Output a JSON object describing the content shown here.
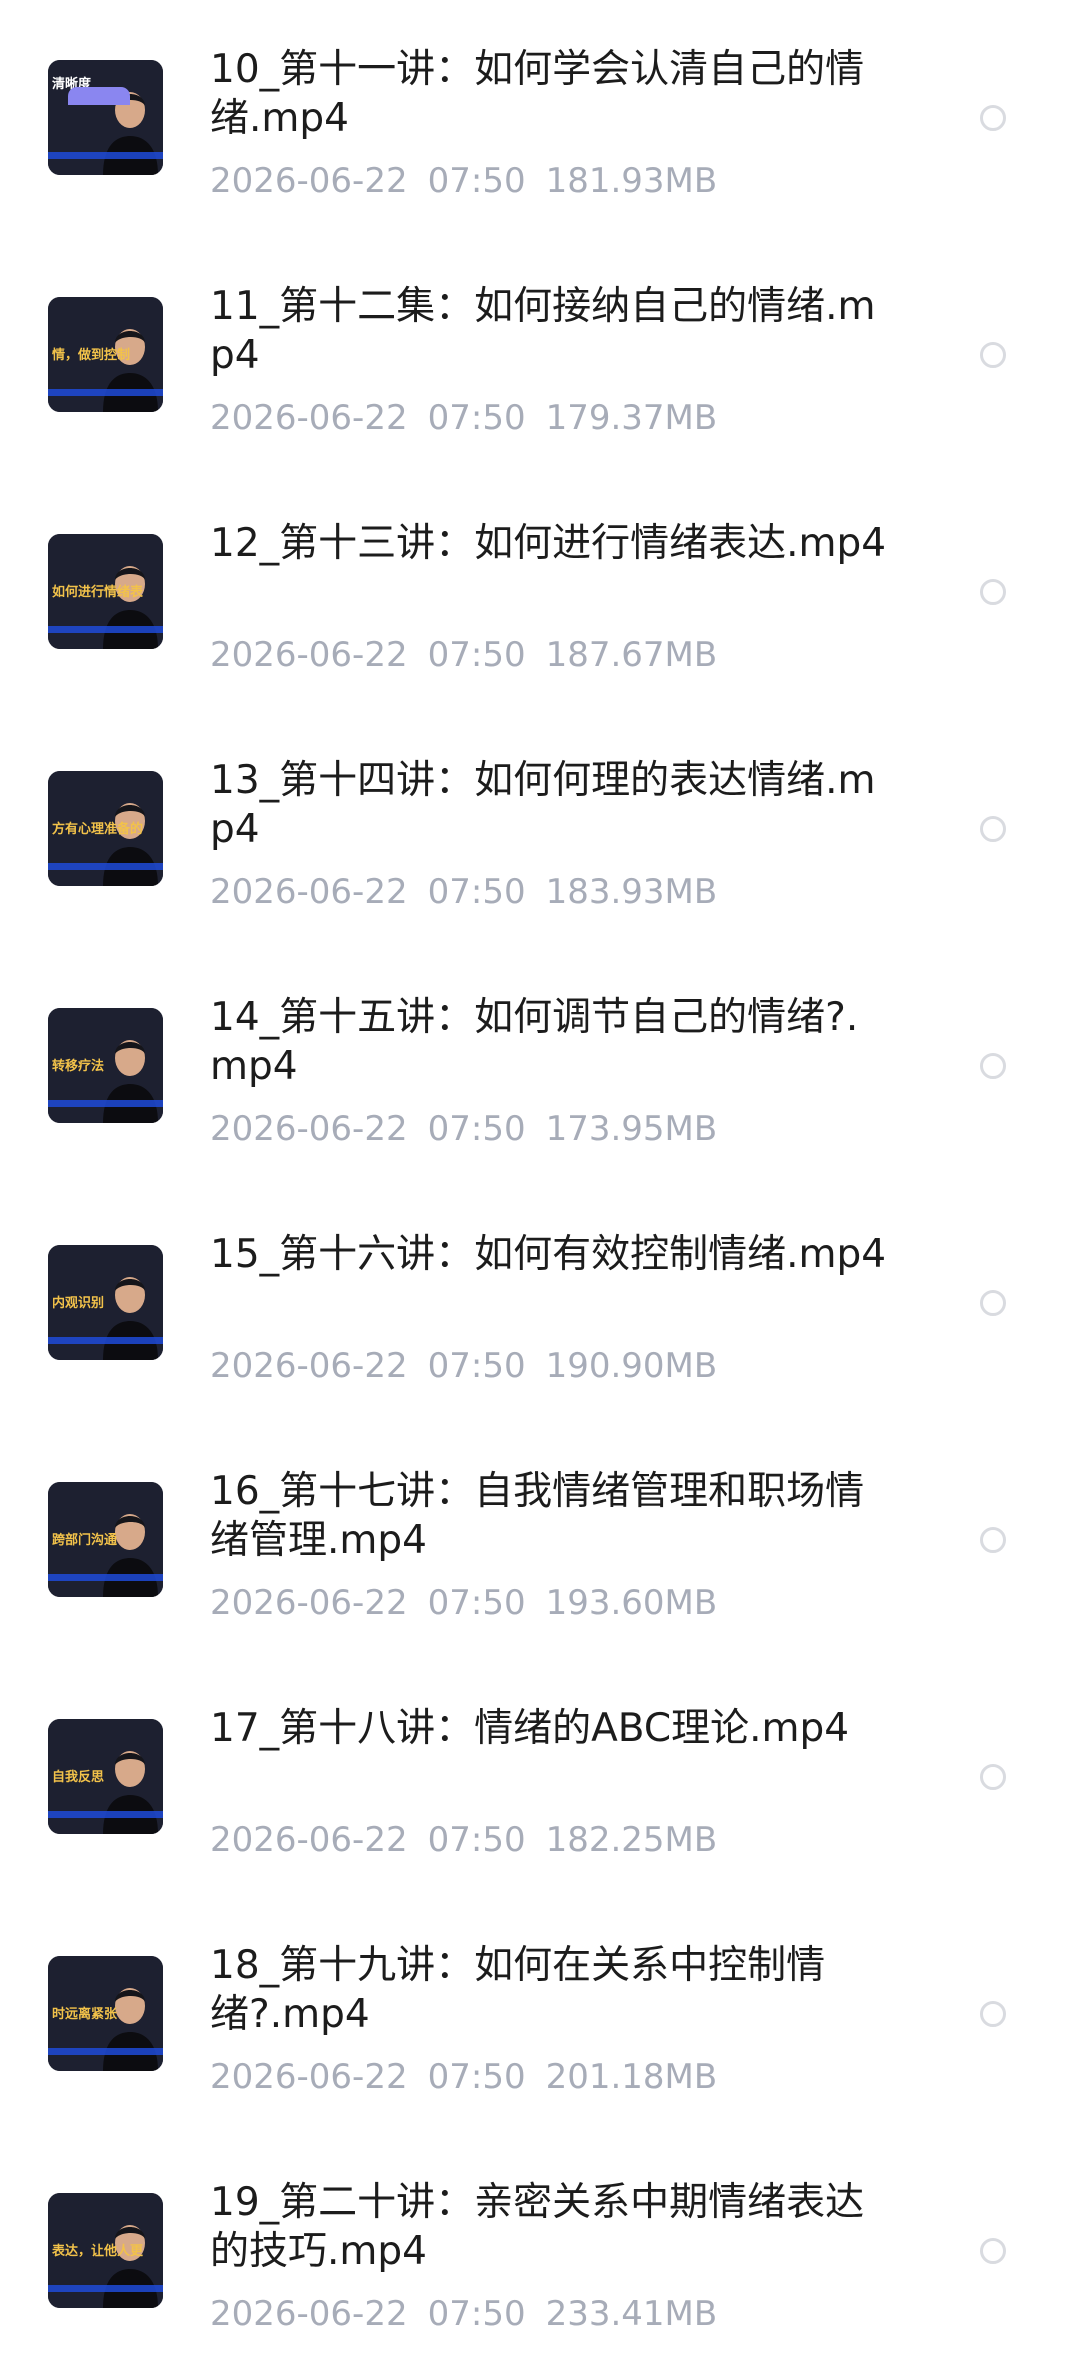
{
  "files": [
    {
      "name": "10_第十一讲：如何学会认清自己的情绪.mp4",
      "date": "2026-06-22",
      "time": "07:50",
      "size": "181.93MB",
      "thumb_caption": "清晰度"
    },
    {
      "name": "11_第十二集：如何接纳自己的情绪.mp4",
      "date": "2026-06-22",
      "time": "07:50",
      "size": "179.37MB",
      "thumb_caption": "情，做到控制"
    },
    {
      "name": "12_第十三讲：如何进行情绪表达.mp4",
      "date": "2026-06-22",
      "time": "07:50",
      "size": "187.67MB",
      "thumb_caption": "如何进行情绪表"
    },
    {
      "name": "13_第十四讲：如何何理的表达情绪.mp4",
      "date": "2026-06-22",
      "time": "07:50",
      "size": "183.93MB",
      "thumb_caption": "方有心理准备的"
    },
    {
      "name": "14_第十五讲：如何调节自己的情绪?.mp4",
      "date": "2026-06-22",
      "time": "07:50",
      "size": "173.95MB",
      "thumb_caption": "转移疗法"
    },
    {
      "name": "15_第十六讲：如何有效控制情绪.mp4",
      "date": "2026-06-22",
      "time": "07:50",
      "size": "190.90MB",
      "thumb_caption": "内观识别"
    },
    {
      "name": "16_第十七讲：自我情绪管理和职场情绪管理.mp4",
      "date": "2026-06-22",
      "time": "07:50",
      "size": "193.60MB",
      "thumb_caption": "跨部门沟通"
    },
    {
      "name": "17_第十八讲：情绪的ABC理论.mp4",
      "date": "2026-06-22",
      "time": "07:50",
      "size": "182.25MB",
      "thumb_caption": "自我反思"
    },
    {
      "name": "18_第十九讲：如何在关系中控制情绪?.mp4",
      "date": "2026-06-22",
      "time": "07:50",
      "size": "201.18MB",
      "thumb_caption": "时远离紧张"
    },
    {
      "name": "19_第二十讲：亲密关系中期情绪表达的技巧.mp4",
      "date": "2026-06-22",
      "time": "07:50",
      "size": "233.41MB",
      "thumb_caption": "表达，让他人更"
    }
  ],
  "colors": {
    "title": "#1c1c1c",
    "meta": "#a7acb8",
    "radio_border": "#d9dbe0",
    "thumb_bg": "#1d2030",
    "thumb_caption": "#f2c24a",
    "thumb_band": "#1f4bd8",
    "badge": "#8a86f0"
  },
  "icons": {
    "thumbnail": "video-thumbnail-icon",
    "select": "radio-unchecked-icon"
  }
}
